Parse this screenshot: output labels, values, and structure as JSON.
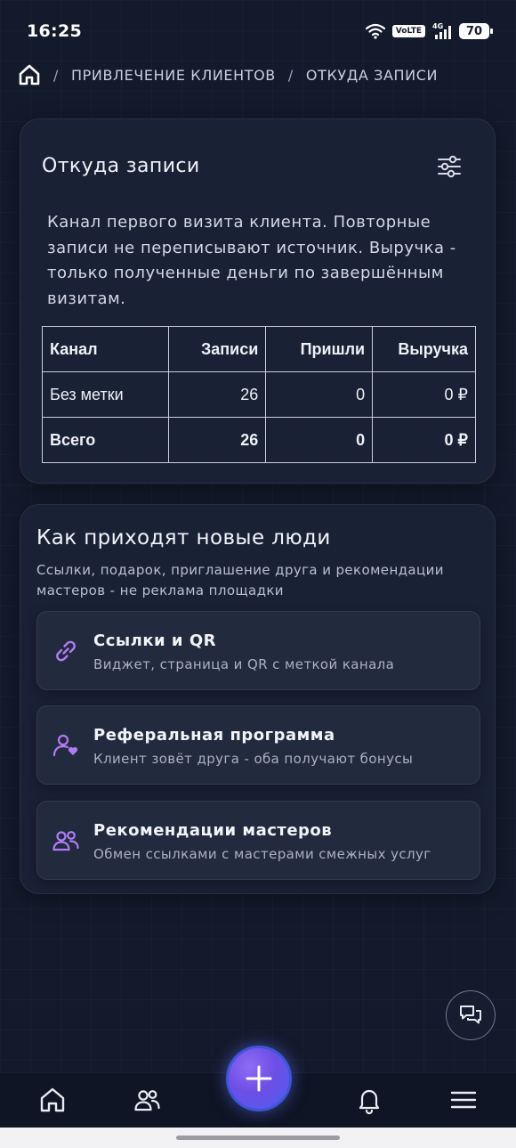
{
  "status_bar": {
    "time": "16:25",
    "network": "4G",
    "volte": "VoLTE",
    "battery": "70"
  },
  "breadcrumb": {
    "separator": "/",
    "items": [
      "ПРИВЛЕЧЕНИЕ КЛИЕНТОВ",
      "ОТКУДА ЗАПИСИ"
    ]
  },
  "sources_card": {
    "title": "Откуда записи",
    "description": "Канал первого визита клиента. Повторные записи не переписывают источник. Выручка - только полученные деньги по завершённым визитам.",
    "table": {
      "headers": [
        "Канал",
        "Записи",
        "Пришли",
        "Выручка"
      ],
      "rows": [
        [
          "Без метки",
          "26",
          "0",
          "0 ₽"
        ]
      ],
      "total": [
        "Всего",
        "26",
        "0",
        "0 ₽"
      ]
    }
  },
  "acquisition_card": {
    "title": "Как приходят новые люди",
    "subtitle": "Ссылки, подарок, приглашение друга и рекомендации мастеров - не реклама площадки",
    "items": [
      {
        "title": "Ссылки и QR",
        "subtitle": "Виджет, страница и QR с меткой канала",
        "icon": "link-icon"
      },
      {
        "title": "Реферальная программа",
        "subtitle": "Клиент зовёт друга - оба получают бонусы",
        "icon": "user-heart-icon"
      },
      {
        "title": "Рекомендации мастеров",
        "subtitle": "Обмен ссылками с мастерами смежных услуг",
        "icon": "users-icon"
      }
    ]
  },
  "bottom_nav": [
    "home-icon",
    "clients-icon",
    "add-icon",
    "bell-icon",
    "menu-icon"
  ],
  "colors": {
    "accent": "#8b5cf6",
    "background": "#131a2b",
    "card": "#1a2236"
  }
}
